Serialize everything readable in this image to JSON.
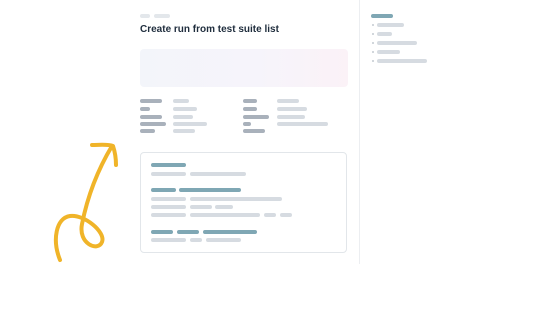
{
  "header": {
    "title": "Create run from test suite list"
  },
  "colors": {
    "accent": "#7fa7b4",
    "arrow": "#f0b429",
    "banner_start": "#f3f5fa",
    "banner_end": "#fbf2f7"
  },
  "decoration": {
    "arrow_icon": "curly-arrow-icon"
  }
}
